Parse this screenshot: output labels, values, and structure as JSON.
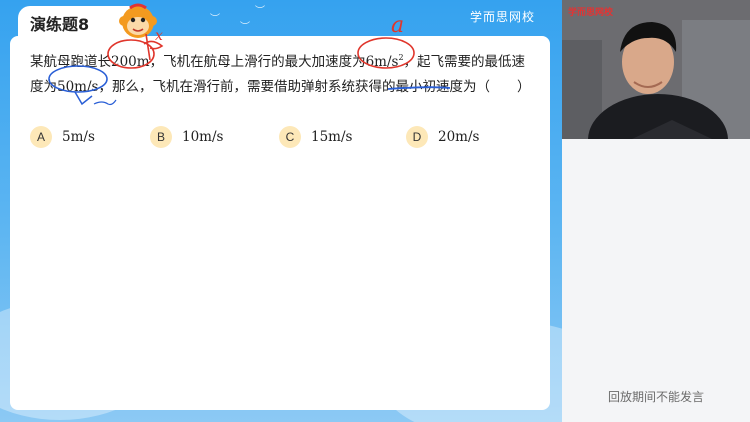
{
  "brand": "学而思网校",
  "title": "演练题8",
  "question": {
    "part1": "某航母跑道长",
    "v1": "200m",
    "part2": "，飞机在航母上滑行的最大加速度为",
    "v2": "6m/s",
    "v2sup": "2",
    "part3": "，起飞需要的最低速",
    "part4": "度为",
    "v3": "50m/s",
    "part5": "，那么，飞机在滑行前，需要借助弹射系统获得的",
    "part6": "最小初速度",
    "part7": "为（　　）"
  },
  "options": [
    {
      "key": "A",
      "value": "5m/s"
    },
    {
      "key": "B",
      "value": "10m/s"
    },
    {
      "key": "C",
      "value": "15m/s"
    },
    {
      "key": "D",
      "value": "20m/s"
    }
  ],
  "annotations": {
    "x": "x",
    "a": "a",
    "v": "v"
  },
  "video_logo": "学而思网校",
  "notice": "回放期间不能发言",
  "colors": {
    "ink_red": "#e0362c",
    "ink_blue": "#2a5fd6",
    "option_badge": "#fde8b8"
  }
}
